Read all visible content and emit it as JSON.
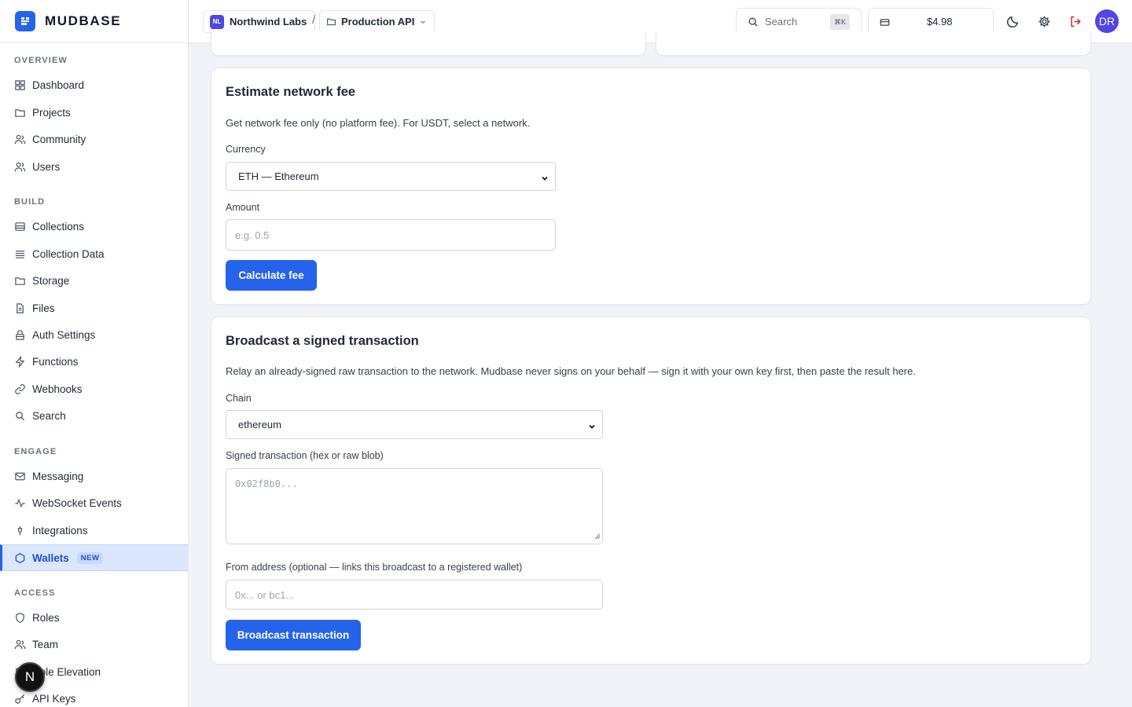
{
  "brand": {
    "name": "MUDBASE",
    "logo_icon": "database-icon",
    "accent": "#2563eb"
  },
  "sidebar": {
    "sections": [
      {
        "heading": "OVERVIEW",
        "items": [
          {
            "label": "Dashboard",
            "icon": "grid-icon"
          },
          {
            "label": "Projects",
            "icon": "folder-icon"
          },
          {
            "label": "Community",
            "icon": "users-icon"
          },
          {
            "label": "Users",
            "icon": "users-icon"
          }
        ]
      },
      {
        "heading": "BUILD",
        "items": [
          {
            "label": "Collections",
            "icon": "collection-icon"
          },
          {
            "label": "Collection Data",
            "icon": "rows-icon"
          },
          {
            "label": "Storage",
            "icon": "folder-icon"
          },
          {
            "label": "Files",
            "icon": "file-icon"
          },
          {
            "label": "Auth Settings",
            "icon": "lock-icon"
          },
          {
            "label": "Functions",
            "icon": "bolt-icon"
          },
          {
            "label": "Webhooks",
            "icon": "link-icon"
          },
          {
            "label": "Search",
            "icon": "search-icon"
          }
        ]
      },
      {
        "heading": "ENGAGE",
        "items": [
          {
            "label": "Messaging",
            "icon": "mail-icon"
          },
          {
            "label": "WebSocket Events",
            "icon": "activity-icon"
          },
          {
            "label": "Integrations",
            "icon": "plug-icon"
          },
          {
            "label": "Wallets",
            "icon": "hexagon-icon",
            "badge": "NEW",
            "active": true
          }
        ]
      },
      {
        "heading": "ACCESS",
        "items": [
          {
            "label": "Roles",
            "icon": "shield-icon"
          },
          {
            "label": "Team",
            "icon": "users-icon"
          },
          {
            "label": "Role Elevation",
            "icon": "shield-icon"
          },
          {
            "label": "API Keys",
            "icon": "key-icon"
          }
        ]
      }
    ],
    "fab_label": "N"
  },
  "topbar": {
    "org": {
      "initials": "NL",
      "name": "Northwind Labs"
    },
    "separator": "/",
    "project": {
      "name": "Production API"
    },
    "search": {
      "label": "Search",
      "shortcut": "⌘K"
    },
    "balance": "$4.98",
    "user_initials": "DR"
  },
  "fee_card": {
    "title": "Estimate network fee",
    "description": "Get network fee only (no platform fee). For USDT, select a network.",
    "currency_label": "Currency",
    "currency_value": "ETH — Ethereum",
    "amount_label": "Amount",
    "amount_placeholder": "e.g. 0.5",
    "button": "Calculate fee"
  },
  "broadcast_card": {
    "title": "Broadcast a signed transaction",
    "description": "Relay an already-signed raw transaction to the network. Mudbase never signs on your behalf — sign it with your own key first, then paste the result here.",
    "chain_label": "Chain",
    "chain_value": "ethereum",
    "signed_label": "Signed transaction (hex or raw blob)",
    "signed_placeholder": "0x02f8b0...",
    "from_label": "From address (optional — links this broadcast to a registered wallet)",
    "from_placeholder": "0x... or bc1...",
    "button": "Broadcast transaction"
  }
}
